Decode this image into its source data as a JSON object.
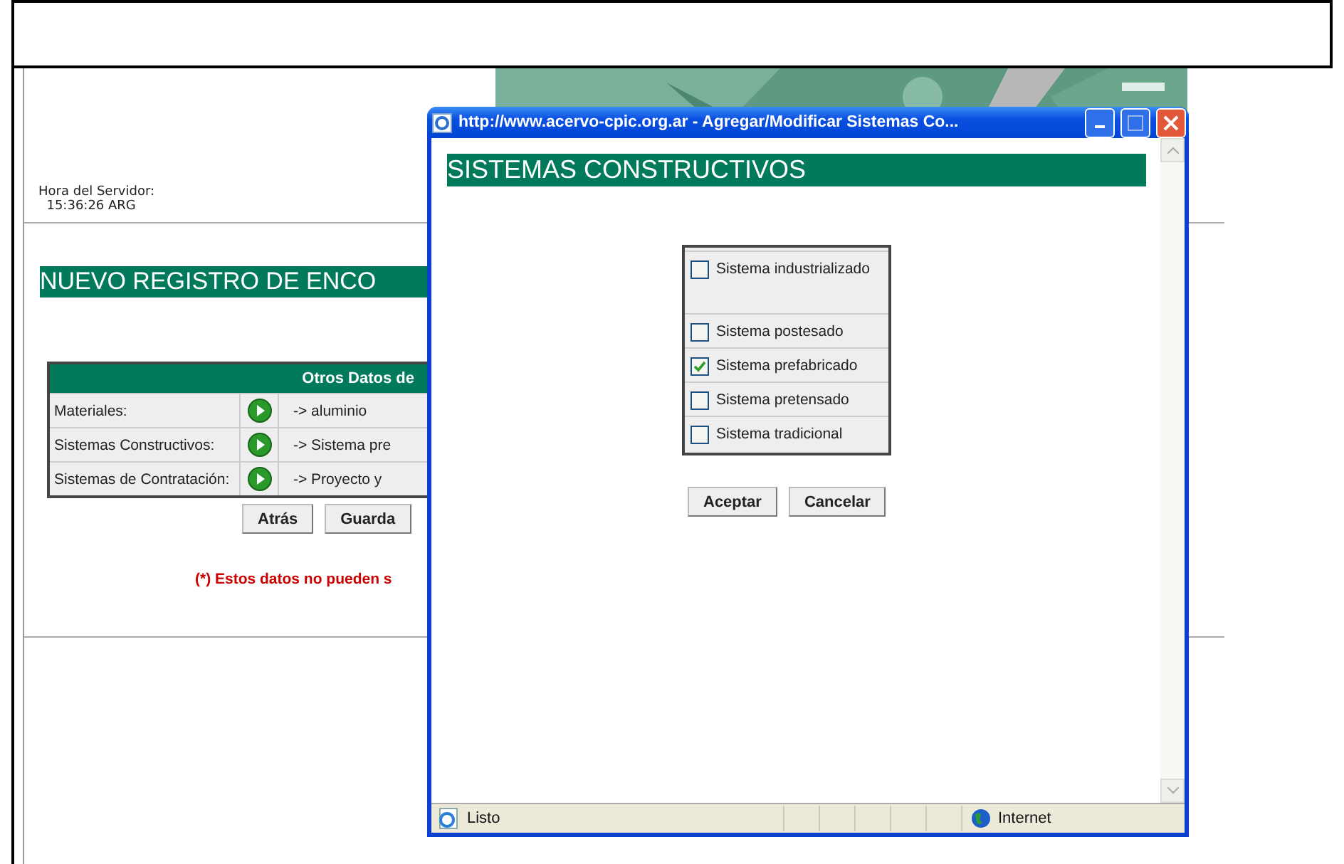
{
  "server_time": {
    "label": "Hora del Servidor:",
    "value": "15:36:26 ARG"
  },
  "page_title": "NUEVO REGISTRO DE ENCO",
  "table": {
    "header": "Otros Datos de",
    "rows": [
      {
        "label": "Materiales:",
        "value": "-> aluminio"
      },
      {
        "label": "Sistemas Constructivos:",
        "value": "-> Sistema pre"
      },
      {
        "label": "Sistemas de Contratación:",
        "value": "-> Proyecto y"
      }
    ]
  },
  "buttons": [
    "Atrás",
    "Guarda"
  ],
  "note": "(*) Estos datos no pueden s",
  "popup": {
    "title": "http://www.acervo-cpic.org.ar - Agregar/Modificar Sistemas Co...",
    "heading": "SISTEMAS CONSTRUCTIVOS",
    "options": [
      {
        "label": "Sistema industrializado",
        "checked": false
      },
      {
        "label": "Sistema postesado",
        "checked": false
      },
      {
        "label": "Sistema prefabricado",
        "checked": true
      },
      {
        "label": "Sistema pretensado",
        "checked": false
      },
      {
        "label": "Sistema tradicional",
        "checked": false
      }
    ],
    "buttons": [
      "Aceptar",
      "Cancelar"
    ],
    "status": "Listo",
    "zone": "Internet"
  }
}
